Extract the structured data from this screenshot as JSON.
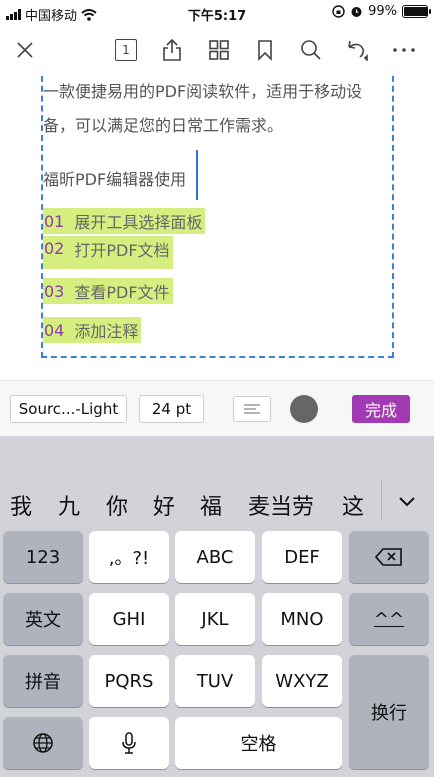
{
  "status_bar": {
    "carrier": "中国移动",
    "time": "下午5:17",
    "battery_text": "99%",
    "battery_level": 0.99,
    "icons": [
      "signal-icon",
      "wifi-icon",
      "orientation-lock-icon",
      "alarm-icon",
      "battery-icon"
    ]
  },
  "toolbar": {
    "page_number": "1",
    "icons": [
      "close-icon",
      "page-indicator",
      "share-icon",
      "grid-icon",
      "bookmark-icon",
      "search-icon",
      "undo-icon",
      "more-icon"
    ]
  },
  "document": {
    "paragraph_lines": [
      "一款便捷易用的PDF阅读软件，适用于移动设",
      "备，可以满足您的日常工作需求。"
    ],
    "editing_text": "福昕PDF编辑器使用",
    "list": [
      {
        "num": "01",
        "text": "展开工具选择面板"
      },
      {
        "num": "02",
        "text": "打开PDF文档"
      },
      {
        "num": "03",
        "text": "查看PDF文件"
      },
      {
        "num": "04",
        "text": "添加注释"
      }
    ],
    "highlight_color": "#d6ee80",
    "number_color": "#8b3fa0",
    "box_border_color": "#3b82d6"
  },
  "format_bar": {
    "font": "Sourc...-Light",
    "size": "24 pt",
    "text_color": "#666666",
    "done_label": "完成",
    "done_color": "#a23ab3"
  },
  "keyboard": {
    "candidates": [
      "我",
      "九",
      "你",
      "好",
      "福",
      "麦当劳",
      "这"
    ],
    "row1": [
      "123",
      ",。?!",
      "ABC",
      "DEF"
    ],
    "row2": [
      "英文",
      "GHI",
      "JKL",
      "MNO",
      "^^"
    ],
    "row3": [
      "拼音",
      "PQRS",
      "TUV",
      "WXYZ"
    ],
    "row4": {
      "space": "空格"
    },
    "return_label": "换行"
  }
}
